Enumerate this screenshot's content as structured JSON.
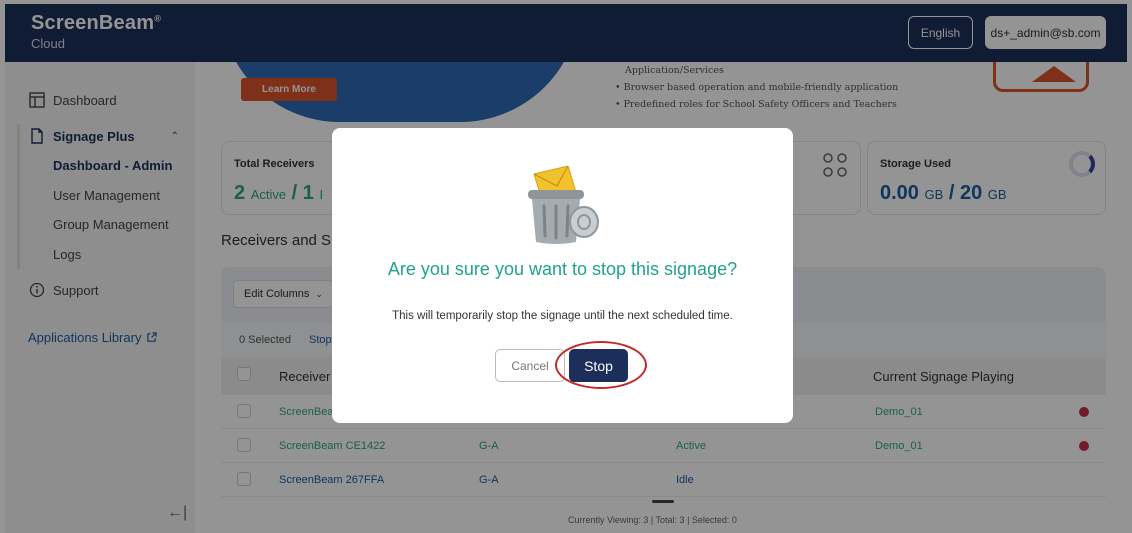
{
  "header": {
    "brand": "ScreenBeam",
    "brand_sub": "Cloud",
    "language": "English",
    "user": "ds+_admin@sb.com"
  },
  "sidebar": {
    "dashboard": "Dashboard",
    "signage_plus": "Signage Plus",
    "sub_items": [
      "Dashboard - Admin",
      "User Management",
      "Group Management",
      "Logs"
    ],
    "support": "Support",
    "apps_library": "Applications Library",
    "collapse_icon": "←|"
  },
  "banner": {
    "learn_more": "Learn More",
    "bullet_0": "Application/Services",
    "bullet_1": "•  Browser based operation and mobile-friendly application",
    "bullet_2": "•  Predefined roles for School Safety Officers and Teachers"
  },
  "stats": {
    "total_receivers": {
      "title": "Total Receivers",
      "active_count": "2",
      "active_label": "Active",
      "sep": "/",
      "other_count": "1",
      "other_label": "I"
    },
    "storage": {
      "title": "Storage Used",
      "used": "0.00",
      "used_unit": "GB",
      "sep": "/",
      "total": "20",
      "total_unit": "GB"
    }
  },
  "section_title": "Receivers and Si",
  "table": {
    "edit_columns": "Edit Columns",
    "selected_text": "0 Selected",
    "stop_link": "Stop",
    "headers": {
      "receiver": "Receiver I",
      "current_signage": "Current Signage Playing"
    },
    "rows": [
      {
        "receiver": "ScreenBea",
        "group": "",
        "status": "",
        "signage": "Demo_01"
      },
      {
        "receiver": "ScreenBeam CE1422",
        "group": "G-A",
        "status": "Active",
        "signage": "Demo_01"
      },
      {
        "receiver": "ScreenBeam 267FFA",
        "group": "G-A",
        "status": "Idle",
        "signage": ""
      }
    ],
    "footer": "Currently Viewing: 3  |  Total: 3  |  Selected: 0"
  },
  "modal": {
    "title": "Are you sure you want to stop this signage?",
    "message": "This will temporarily stop the signage until the next scheduled time.",
    "cancel": "Cancel",
    "stop": "Stop",
    "icon": "trash-can-icon"
  },
  "colors": {
    "navy": "#1c2f5b",
    "teal": "#21a38b",
    "green": "#2fa67a",
    "highlight": "#c62828"
  }
}
